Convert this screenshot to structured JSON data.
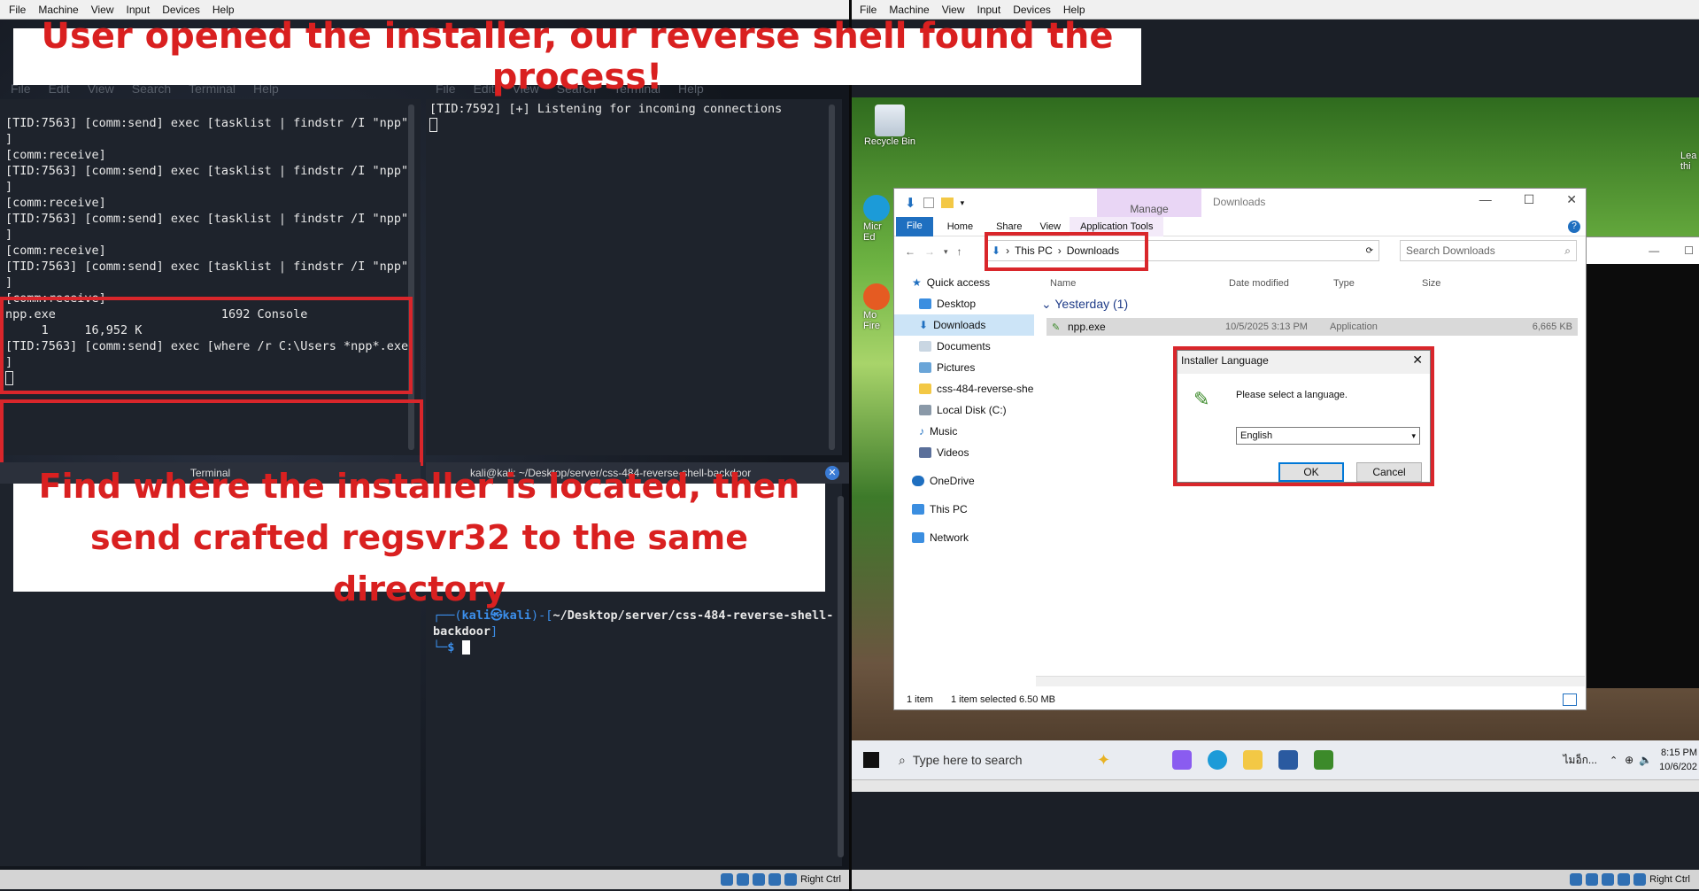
{
  "left_vm": {
    "menu": [
      "File",
      "Machine",
      "View",
      "Input",
      "Devices",
      "Help"
    ],
    "status_label": "Right Ctrl"
  },
  "right_vm": {
    "menu": [
      "File",
      "Machine",
      "View",
      "Input",
      "Devices",
      "Help"
    ],
    "status_label": "Right Ctrl"
  },
  "caption_top": "User opened the installer, our reverse shell found the process!",
  "caption_bottom": "Find where the installer is located, then send crafted regsvr32 to the same directory",
  "term_menu_left": [
    "File",
    "Edit",
    "View",
    "Search",
    "Terminal",
    "Help"
  ],
  "term_menu_right": [
    "File",
    "Edit",
    "View",
    "Search",
    "Terminal",
    "Help"
  ],
  "term_left_lines": [
    "[TID:7563] [comm:send] exec [tasklist | findstr /I \"npp\"",
    "]",
    "[comm:receive]",
    "",
    "[TID:7563] [comm:send] exec [tasklist | findstr /I \"npp\"",
    "]",
    "[comm:receive]",
    "",
    "[TID:7563] [comm:send] exec [tasklist | findstr /I \"npp\"",
    "]",
    "[comm:receive]",
    "",
    "[TID:7563] [comm:send] exec [tasklist | findstr /I \"npp\"",
    "]",
    "[comm:receive]",
    "npp.exe                       1692 Console",
    "     1     16,952 K",
    "",
    "[TID:7563] [comm:send] exec [where /r C:\\Users *npp*.exe",
    "]"
  ],
  "term_right_lines": [
    "[TID:7592] [+] Listening for incoming connections"
  ],
  "term_bottom_left_title": "Terminal",
  "term_bottom_right_title": "kali@kali: ~/Desktop/server/css-484-reverse-shell-backdoor",
  "prompt": {
    "user": "kali㉿kali",
    "path": "~/Desktop/server/css-484-reverse-shell-",
    "path_cont": "backdoor",
    "symbol": "$"
  },
  "desktop": {
    "recycle_bin": "Recycle Bin",
    "edge_label": "Micr Ed",
    "firefox_label": "Mo Fire",
    "right_cut": "Lea thi"
  },
  "explorer": {
    "ribbon_manage": "Manage",
    "title": "Downloads",
    "tabs": [
      "File",
      "Home",
      "Share",
      "View",
      "Application Tools"
    ],
    "breadcrumb": [
      "This PC",
      "Downloads"
    ],
    "search_placeholder": "Search Downloads",
    "columns": [
      "Name",
      "Date modified",
      "Type",
      "Size"
    ],
    "group": "Yesterday (1)",
    "file": {
      "name": "npp.exe",
      "date": "10/5/2025 3:13 PM",
      "type": "Application",
      "size": "6,665 KB"
    },
    "nav": [
      "Quick access",
      "Desktop",
      "Downloads",
      "Documents",
      "Pictures",
      "css-484-reverse-she",
      "Local Disk (C:)",
      "Music",
      "Videos",
      "OneDrive",
      "This PC",
      "Network"
    ],
    "status": [
      "1 item",
      "1 item selected  6.50 MB"
    ]
  },
  "dialog": {
    "title": "Installer Language",
    "prompt": "Please select a language.",
    "selected": "English",
    "ok": "OK",
    "cancel": "Cancel"
  },
  "taskbar": {
    "search": "Type here to search",
    "lang": "ไมอ็ก...",
    "time": "8:15 PM",
    "date": "10/6/202"
  }
}
